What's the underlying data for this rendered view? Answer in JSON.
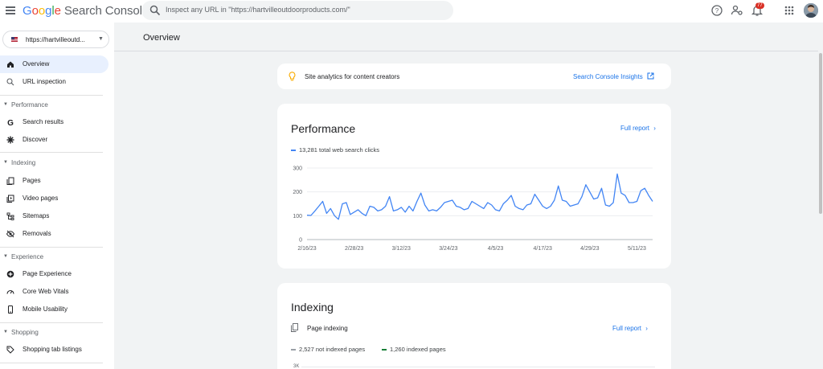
{
  "app": {
    "logo_google": [
      "G",
      "o",
      "o",
      "g",
      "l",
      "e"
    ],
    "logo_rest": "Search Console",
    "search_placeholder": "Inspect any URL in \"https://hartvilleoutdoorproducts.com/\"",
    "notification_count": "77"
  },
  "property": {
    "label": "https://hartvilleoutd..."
  },
  "sidebar": {
    "overview": "Overview",
    "url_inspection": "URL inspection",
    "performance_section": "Performance",
    "search_results": "Search results",
    "discover": "Discover",
    "indexing_section": "Indexing",
    "pages": "Pages",
    "video_pages": "Video pages",
    "sitemaps": "Sitemaps",
    "removals": "Removals",
    "experience_section": "Experience",
    "page_experience": "Page Experience",
    "core_web_vitals": "Core Web Vitals",
    "mobile_usability": "Mobile Usability",
    "shopping_section": "Shopping",
    "shopping_tab_listings": "Shopping tab listings"
  },
  "main": {
    "title": "Overview",
    "insights_text": "Site analytics for content creators",
    "insights_link": "Search Console Insights",
    "performance_title": "Performance",
    "full_report": "Full report",
    "indexing_title": "Indexing",
    "page_indexing": "Page indexing",
    "indexing_legend": {
      "not_indexed": "2,527 not indexed pages",
      "indexed": "1,260 indexed pages"
    },
    "indexing_axis_top": "3K"
  },
  "colors": {
    "accent": "#1a73e8",
    "line": "#4285f4",
    "not_indexed": "#9aa0a6",
    "indexed": "#188038"
  },
  "chart_data": {
    "type": "line",
    "title": "",
    "series": [
      {
        "name": "13,281 total web search clicks"
      }
    ],
    "xlabel": "",
    "ylabel": "",
    "ylim": [
      0,
      300
    ],
    "yticks": [
      "0",
      "100",
      "200",
      "300"
    ],
    "xticks": [
      "2/16/23",
      "2/28/23",
      "3/12/23",
      "3/24/23",
      "4/5/23",
      "4/17/23",
      "4/29/23",
      "5/11/23"
    ],
    "x": [
      "2/16/23",
      "2/17/23",
      "2/18/23",
      "2/19/23",
      "2/20/23",
      "2/21/23",
      "2/22/23",
      "2/23/23",
      "2/24/23",
      "2/25/23",
      "2/26/23",
      "2/27/23",
      "2/28/23",
      "3/1/23",
      "3/2/23",
      "3/3/23",
      "3/4/23",
      "3/5/23",
      "3/6/23",
      "3/7/23",
      "3/8/23",
      "3/9/23",
      "3/10/23",
      "3/11/23",
      "3/12/23",
      "3/13/23",
      "3/14/23",
      "3/15/23",
      "3/16/23",
      "3/17/23",
      "3/18/23",
      "3/19/23",
      "3/20/23",
      "3/21/23",
      "3/22/23",
      "3/23/23",
      "3/24/23",
      "3/25/23",
      "3/26/23",
      "3/27/23",
      "3/28/23",
      "3/29/23",
      "3/30/23",
      "3/31/23",
      "4/1/23",
      "4/2/23",
      "4/3/23",
      "4/4/23",
      "4/5/23",
      "4/6/23",
      "4/7/23",
      "4/8/23",
      "4/9/23",
      "4/10/23",
      "4/11/23",
      "4/12/23",
      "4/13/23",
      "4/14/23",
      "4/15/23",
      "4/16/23",
      "4/17/23",
      "4/18/23",
      "4/19/23",
      "4/20/23",
      "4/21/23",
      "4/22/23",
      "4/23/23",
      "4/24/23",
      "4/25/23",
      "4/26/23",
      "4/27/23",
      "4/28/23",
      "4/29/23",
      "4/30/23",
      "5/1/23",
      "5/2/23",
      "5/3/23",
      "5/4/23",
      "5/5/23",
      "5/6/23",
      "5/7/23",
      "5/8/23",
      "5/9/23",
      "5/10/23",
      "5/11/23",
      "5/12/23",
      "5/13/23",
      "5/14/23",
      "5/15/23"
    ],
    "values": [
      102,
      101,
      120,
      140,
      160,
      110,
      130,
      100,
      85,
      150,
      155,
      105,
      115,
      125,
      110,
      100,
      140,
      135,
      120,
      125,
      140,
      180,
      120,
      125,
      135,
      115,
      140,
      120,
      160,
      195,
      145,
      120,
      125,
      120,
      135,
      155,
      160,
      165,
      140,
      135,
      125,
      130,
      160,
      150,
      140,
      130,
      155,
      145,
      125,
      120,
      150,
      165,
      185,
      140,
      130,
      125,
      145,
      150,
      190,
      165,
      140,
      130,
      140,
      165,
      225,
      165,
      160,
      140,
      145,
      150,
      180,
      230,
      200,
      170,
      175,
      215,
      145,
      140,
      155,
      275,
      195,
      185,
      155,
      155,
      160,
      205,
      215,
      185,
      160
    ]
  }
}
